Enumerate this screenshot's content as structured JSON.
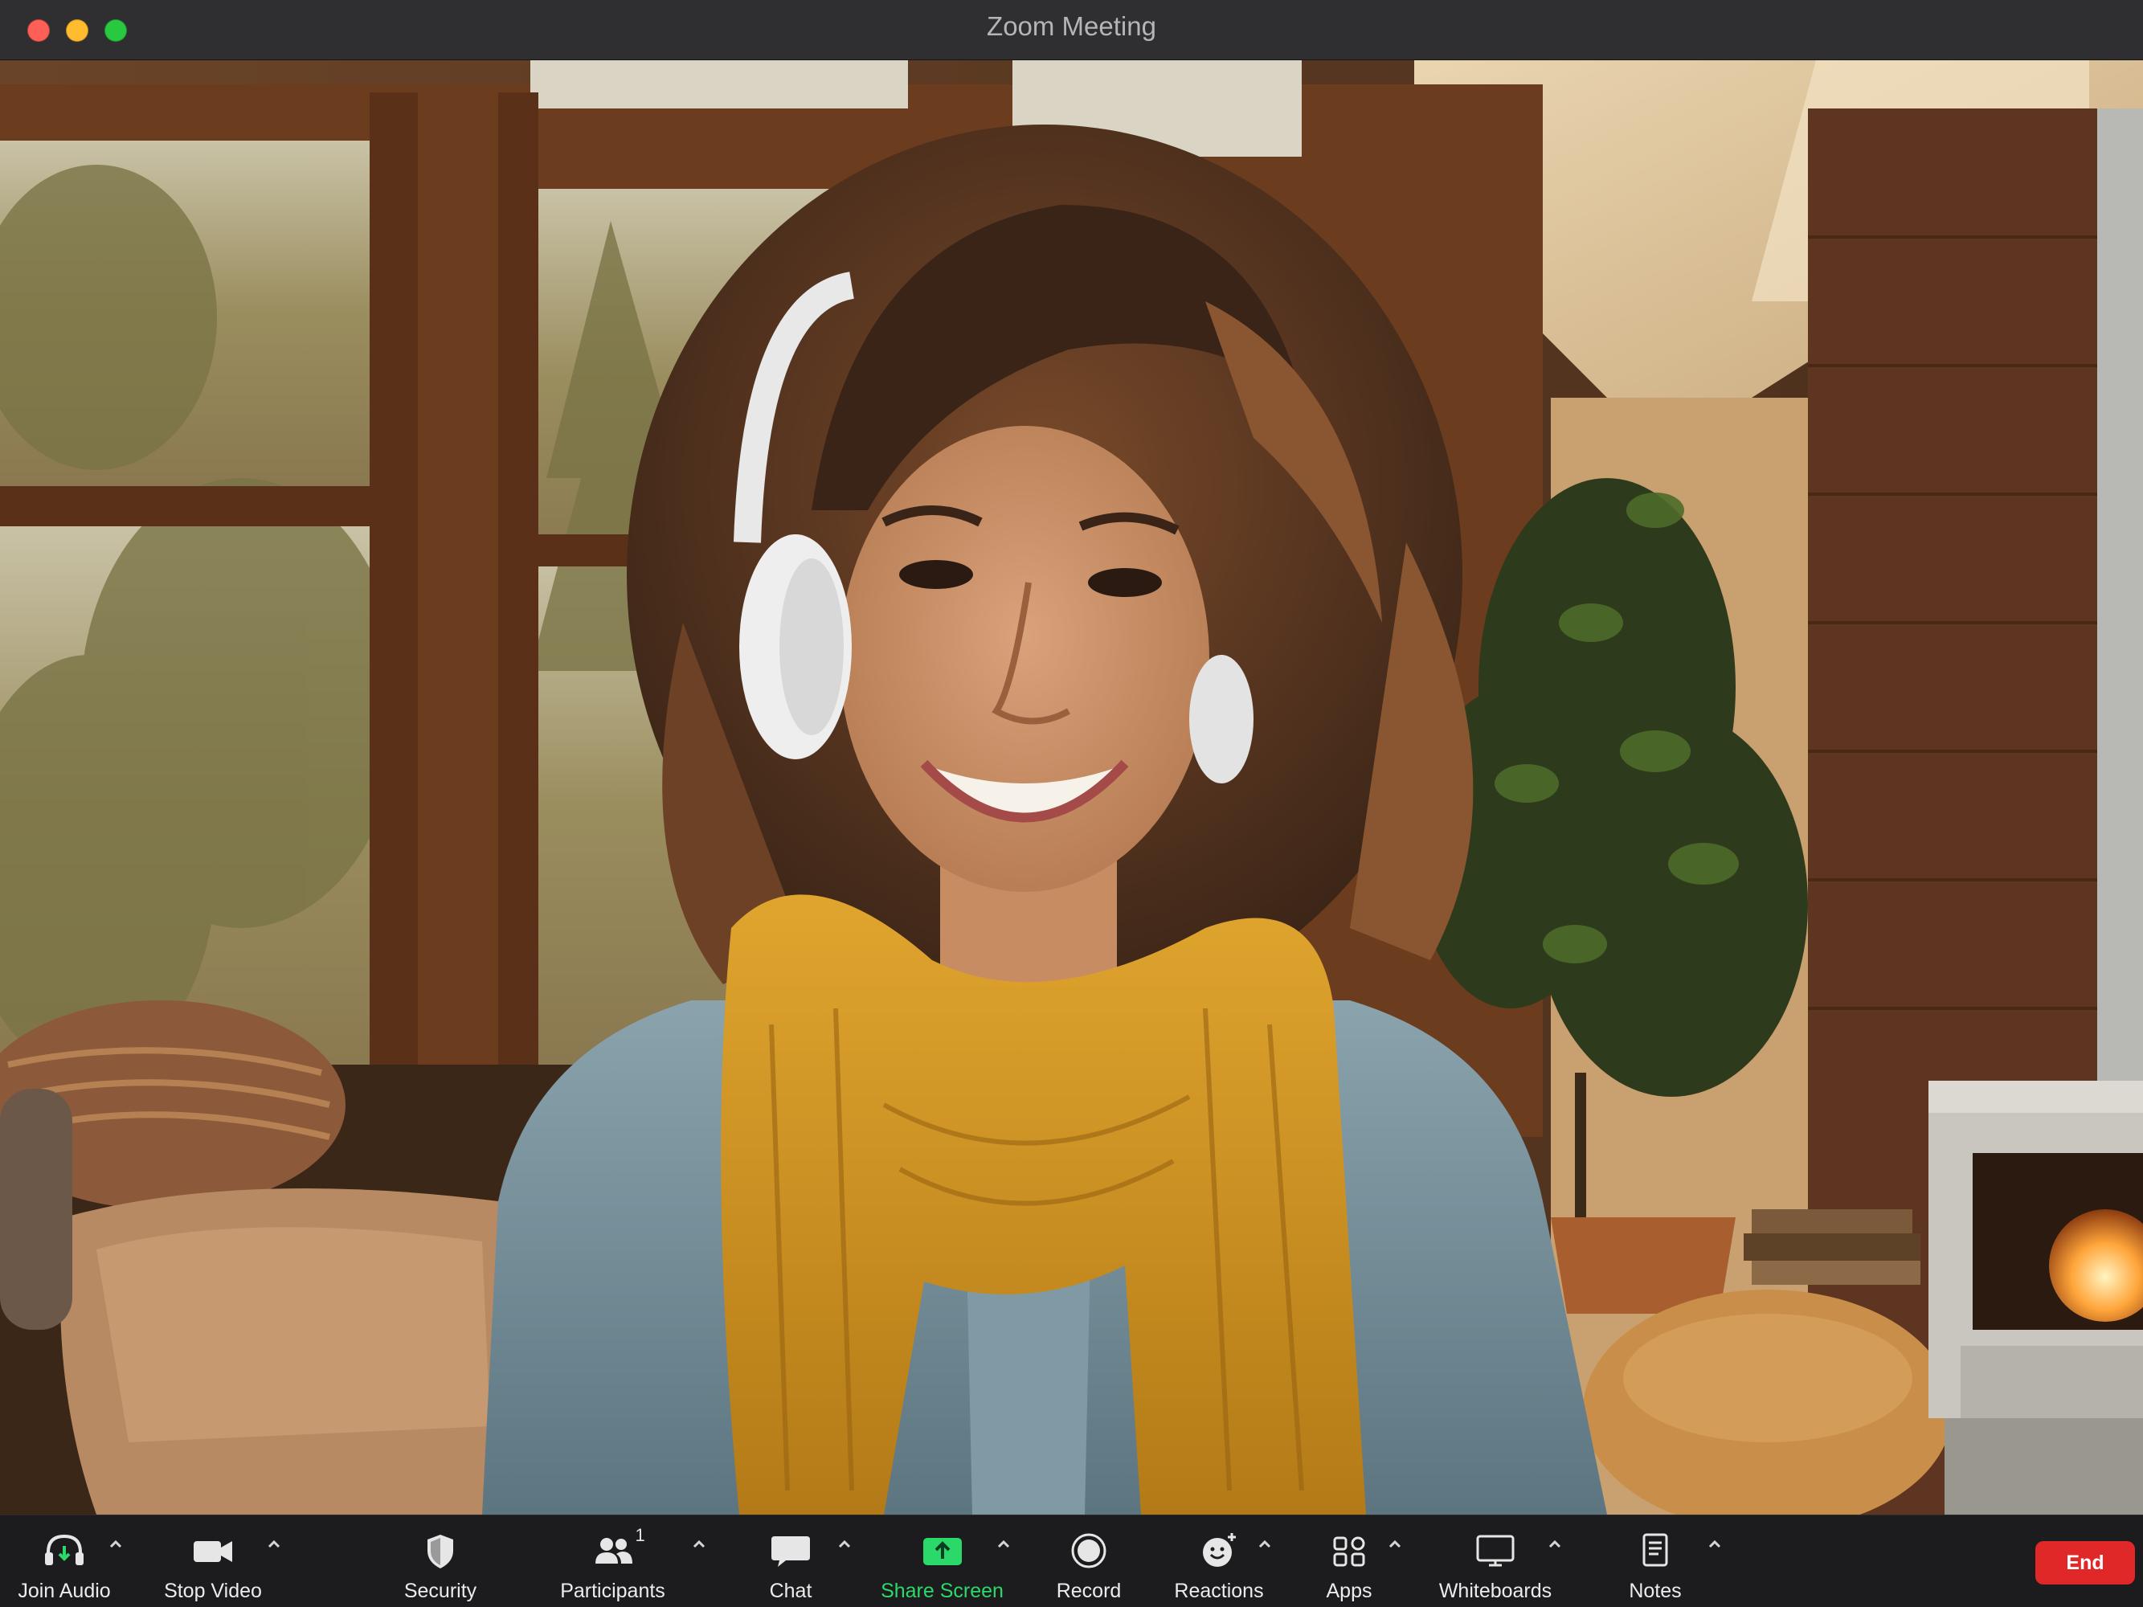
{
  "window": {
    "title": "Zoom Meeting"
  },
  "video": {
    "description_icon": "participant-video-feed"
  },
  "toolbar": {
    "items": [
      {
        "label": "Join Audio",
        "icon": "headphones-icon",
        "has_menu": true
      },
      {
        "label": "Stop Video",
        "icon": "video-camera-icon",
        "has_menu": true
      },
      {
        "label": "Security",
        "icon": "shield-icon",
        "has_menu": false
      },
      {
        "label": "Participants",
        "icon": "participants-icon",
        "has_menu": true,
        "count": "1"
      },
      {
        "label": "Chat",
        "icon": "chat-bubble-icon",
        "has_menu": true
      },
      {
        "label": "Share Screen",
        "icon": "share-screen-icon",
        "has_menu": true
      },
      {
        "label": "Record",
        "icon": "record-icon",
        "has_menu": false
      },
      {
        "label": "Reactions",
        "icon": "reactions-icon",
        "has_menu": true
      },
      {
        "label": "Apps",
        "icon": "apps-icon",
        "has_menu": true
      },
      {
        "label": "Whiteboards",
        "icon": "whiteboard-icon",
        "has_menu": true
      },
      {
        "label": "Notes",
        "icon": "notes-icon",
        "has_menu": true
      }
    ],
    "end_label": "End"
  },
  "colors": {
    "share_accent": "#2bd96b",
    "end_button": "#e02828",
    "toolbar_bg": "#1c1c1e",
    "titlebar_bg": "#2f2f31"
  }
}
